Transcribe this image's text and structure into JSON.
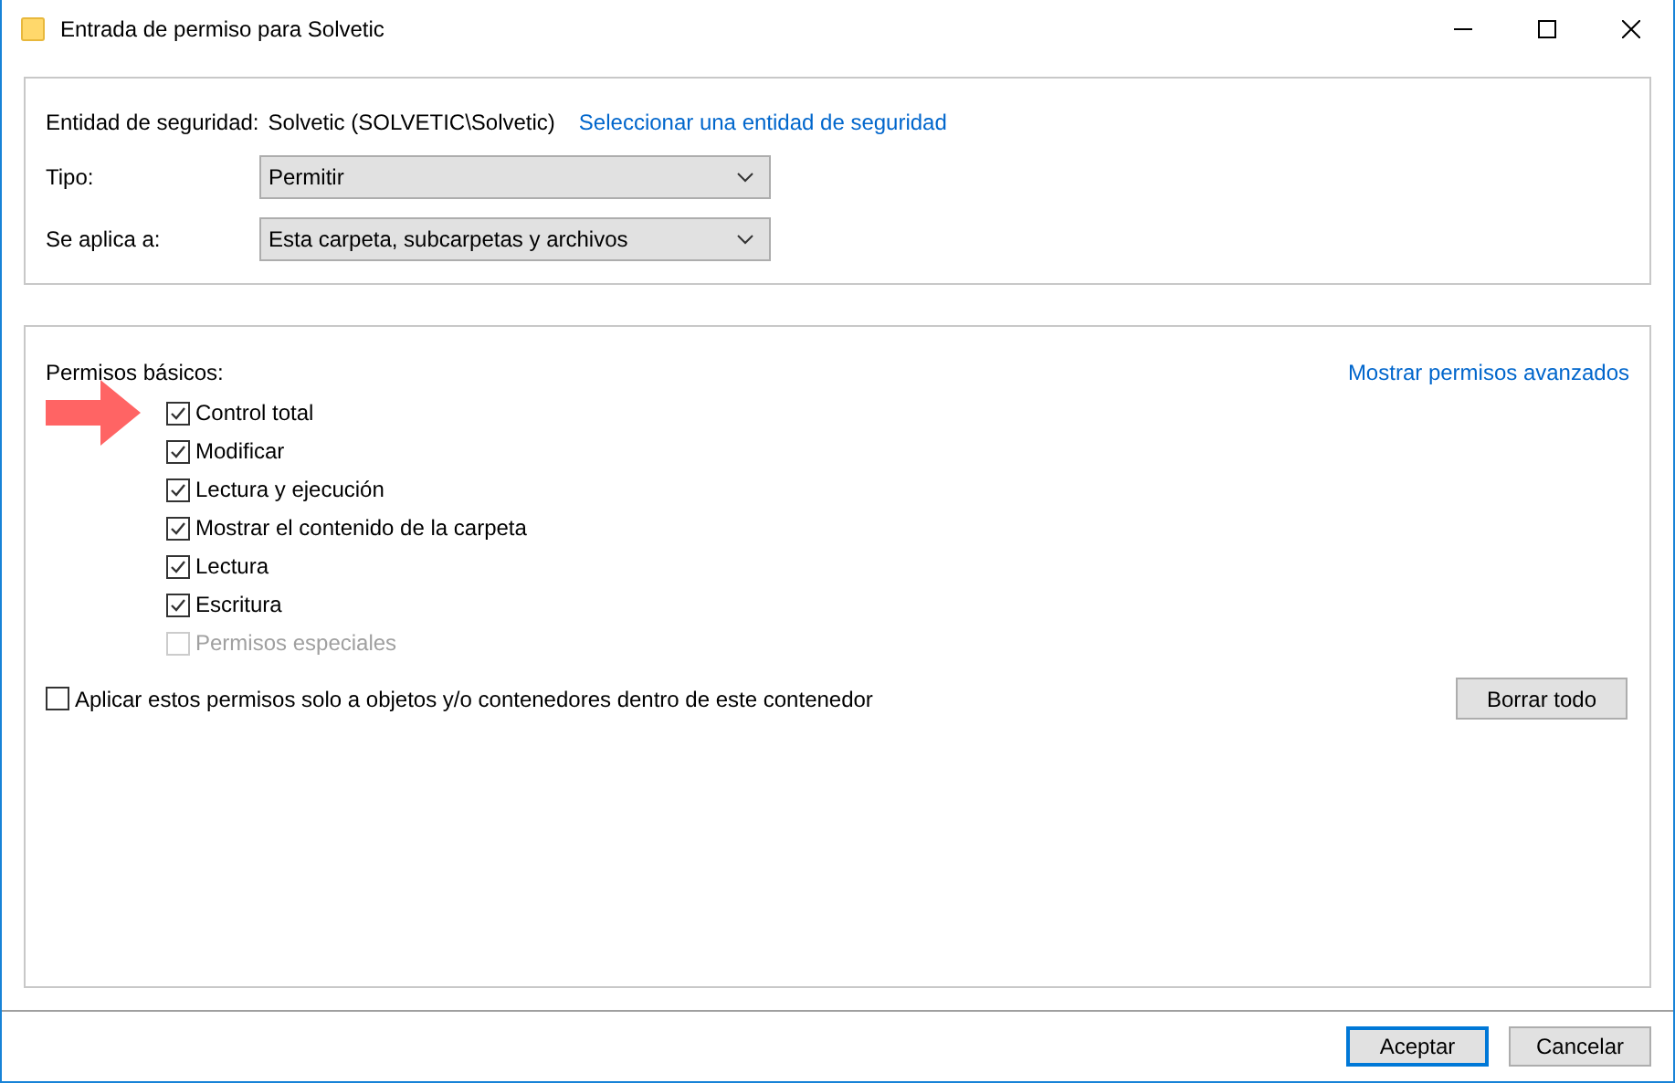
{
  "window": {
    "title": "Entrada de permiso para Solvetic"
  },
  "principal": {
    "label": "Entidad de seguridad:",
    "value": "Solvetic (SOLVETIC\\Solvetic)",
    "link": "Seleccionar una entidad de seguridad"
  },
  "fields": [
    {
      "label": "Tipo:",
      "value": "Permitir"
    },
    {
      "label": "Se aplica a:",
      "value": "Esta carpeta, subcarpetas y archivos"
    }
  ],
  "permissions": {
    "title": "Permisos básicos:",
    "link": "Mostrar permisos avanzados",
    "items": [
      {
        "label": "Control total",
        "checked": true,
        "disabled": false,
        "highlighted": true
      },
      {
        "label": "Modificar",
        "checked": true,
        "disabled": false,
        "highlighted": false
      },
      {
        "label": "Lectura y ejecución",
        "checked": true,
        "disabled": false,
        "highlighted": false
      },
      {
        "label": "Mostrar el contenido de la carpeta",
        "checked": true,
        "disabled": false,
        "highlighted": false
      },
      {
        "label": "Lectura",
        "checked": true,
        "disabled": false,
        "highlighted": false
      },
      {
        "label": "Escritura",
        "checked": true,
        "disabled": false,
        "highlighted": false
      },
      {
        "label": "Permisos especiales",
        "checked": false,
        "disabled": true,
        "highlighted": false
      }
    ]
  },
  "apply_only": {
    "label": "Aplicar estos permisos solo a objetos y/o contenedores dentro de este contenedor",
    "checked": false
  },
  "clear_button": "Borrar todo",
  "buttons": [
    {
      "label": "Aceptar",
      "default": true
    },
    {
      "label": "Cancelar",
      "default": false
    }
  ]
}
